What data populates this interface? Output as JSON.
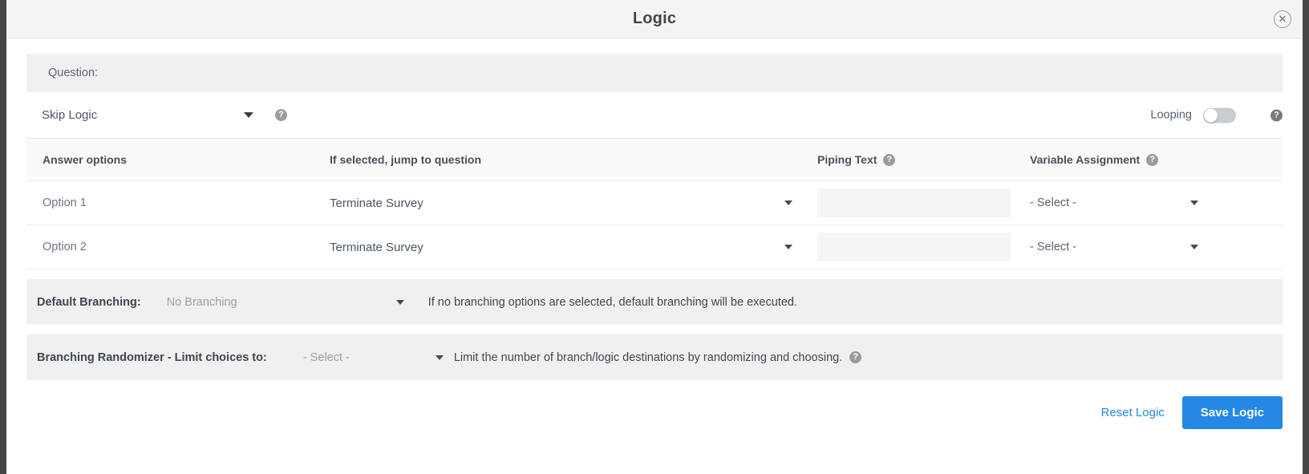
{
  "header": {
    "title": "Logic",
    "close_label": "✕"
  },
  "question": {
    "label": "Question:"
  },
  "logic_type": {
    "value": "Skip Logic",
    "help_glyph": "?"
  },
  "looping": {
    "label": "Looping",
    "state": "off",
    "help_glyph": "?"
  },
  "table": {
    "headers": {
      "answer_options": "Answer options",
      "jump_to_question": "If selected, jump to question",
      "piping_text": "Piping Text",
      "variable_assignment": "Variable Assignment"
    },
    "rows": [
      {
        "answer_option": "Option 1",
        "jump_to": "Terminate Survey",
        "piping_text": "",
        "piping_placeholder": "",
        "variable_assignment": "- Select -"
      },
      {
        "answer_option": "Option 2",
        "jump_to": "Terminate Survey",
        "piping_text": "",
        "piping_placeholder": "",
        "variable_assignment": "- Select -"
      }
    ]
  },
  "default_branching": {
    "label": "Default Branching:",
    "value": "No Branching",
    "hint": "If no branching options are selected, default branching will be executed."
  },
  "branching_randomizer": {
    "label": "Branching Randomizer - Limit choices to:",
    "value": "- Select -",
    "hint": "Limit the number of branch/logic destinations by randomizing and choosing.",
    "help_glyph": "?"
  },
  "footer": {
    "reset_label": "Reset Logic",
    "save_label": "Save Logic"
  },
  "colors": {
    "accent": "#2489e4",
    "link": "#2488e0",
    "panel_grey": "#f0f0f0",
    "header_grey": "#f4f4f4",
    "edge_dark": "#464646"
  }
}
